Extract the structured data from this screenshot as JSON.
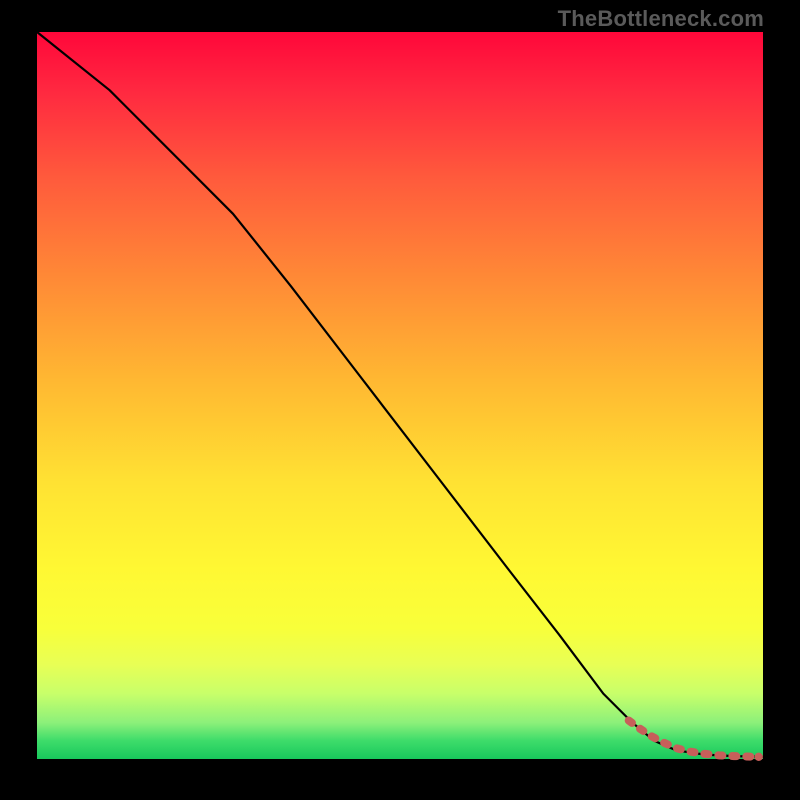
{
  "watermark": "TheBottleneck.com",
  "colors": {
    "frame": "#000000",
    "curve": "#000000",
    "markers": "#c75f5a",
    "gradient_top": "#ff073a",
    "gradient_bottom": "#18c85c"
  },
  "chart_data": {
    "type": "line",
    "title": "",
    "xlabel": "",
    "ylabel": "",
    "xlim": [
      0,
      100
    ],
    "ylim": [
      0,
      100
    ],
    "grid": false,
    "legend": false,
    "series": [
      {
        "name": "curve",
        "x": [
          0,
          10,
          20,
          27,
          35,
          45,
          55,
          65,
          72,
          78,
          82,
          85,
          88,
          92,
          96,
          100
        ],
        "values": [
          100,
          92,
          82,
          75,
          65,
          52,
          39,
          26,
          17,
          9,
          5,
          2.5,
          1.2,
          0.6,
          0.4,
          0.3
        ]
      }
    ],
    "marker_points": {
      "name": "markers",
      "x": [
        81.5,
        83.0,
        84.5,
        86.0,
        88.0,
        90.0,
        92.0,
        94.0,
        96.0,
        99.0
      ],
      "values": [
        5.3,
        4.2,
        3.2,
        2.4,
        1.5,
        1.0,
        0.7,
        0.5,
        0.4,
        0.3
      ]
    }
  }
}
